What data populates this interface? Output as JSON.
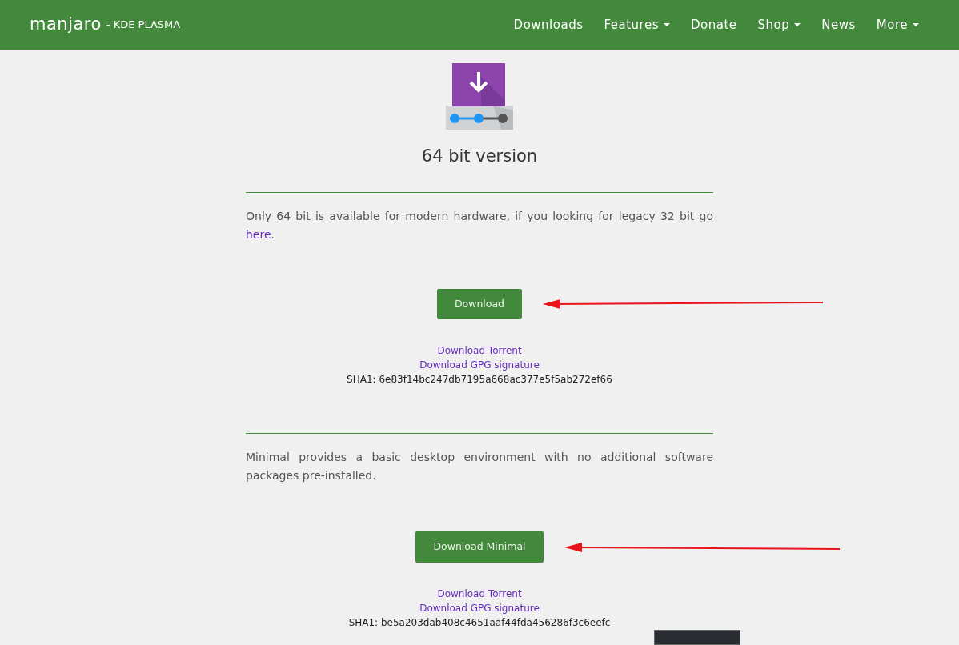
{
  "navbar": {
    "brand": "manjaro",
    "edition": "- KDE PLASMA",
    "items": [
      {
        "label": "Downloads",
        "dropdown": false
      },
      {
        "label": "Features",
        "dropdown": true
      },
      {
        "label": "Donate",
        "dropdown": false
      },
      {
        "label": "Shop",
        "dropdown": true
      },
      {
        "label": "News",
        "dropdown": false
      },
      {
        "label": "More",
        "dropdown": true
      }
    ]
  },
  "heading": "64 bit version",
  "sections": [
    {
      "text_before": "Only 64 bit is available for modern hardware, if you looking for legacy 32 bit go ",
      "link": "here",
      "text_after": ".",
      "button": "Download",
      "arrow": true,
      "links": [
        "Download Torrent",
        "Download GPG signature"
      ],
      "sha": "SHA1: 6e83f14bc247db7195a668ac377e5f5ab272ef66"
    },
    {
      "text_before": "Minimal provides a basic desktop environment with no additional software packages pre-installed.",
      "button": "Download Minimal",
      "arrow": true,
      "links": [
        "Download Torrent",
        "Download GPG signature"
      ],
      "sha": "SHA1: be5a203dab408c4651aaf44fda456286f3c6eefc"
    }
  ],
  "popup": true
}
